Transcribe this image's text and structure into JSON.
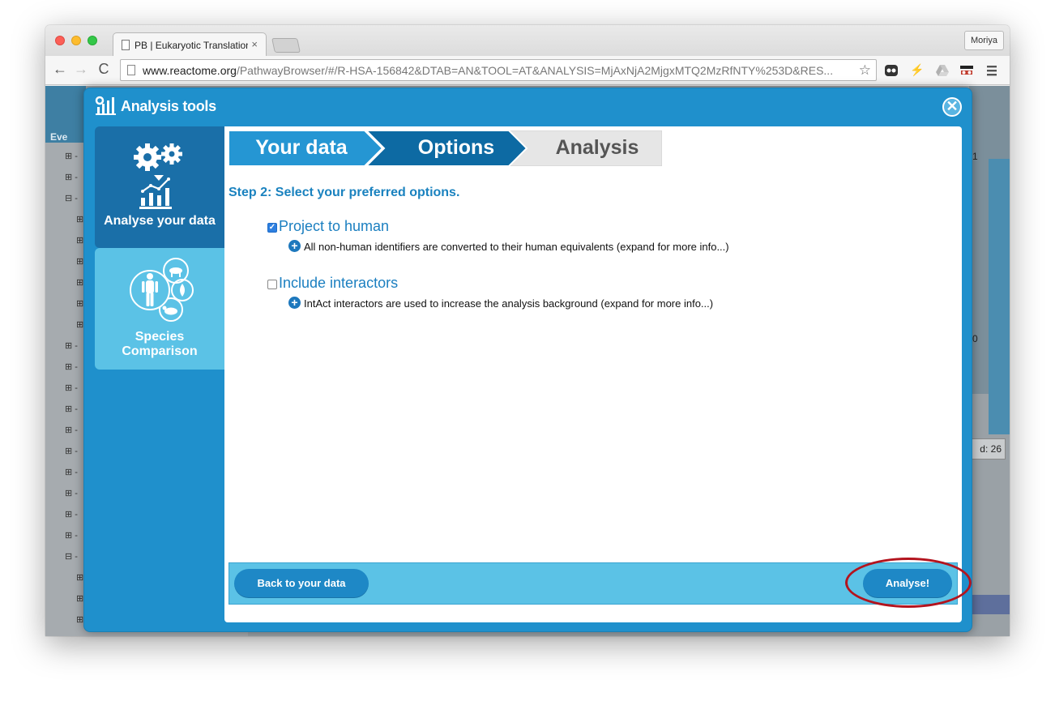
{
  "browser": {
    "tab_title": "PB | Eukaryotic Translation",
    "tab_close": "×",
    "profile_name": "Moriya",
    "url_domain": "www.reactome.org",
    "url_path": "/PathwayBrowser/#/R-HSA-156842&DTAB=AN&TOOL=AT&ANALYSIS=MjAxNjA2MjgxMTQ2MzRfNTY%253D&RES...",
    "back_icon": "←",
    "forward_icon": "→",
    "reload_icon": "C",
    "star_icon": "☆"
  },
  "background": {
    "side_label": "Eve",
    "right_value": "d: 26",
    "right_small_1": "1",
    "right_small_2": "0"
  },
  "dialog": {
    "title": "Analysis tools",
    "close_symbol": "✕",
    "nav": [
      {
        "label": "Analyse your data",
        "icon": "gears-chart-icon"
      },
      {
        "label": "Species Comparison",
        "icon": "species-icon"
      }
    ],
    "steps": [
      {
        "label": "Your data",
        "state": "done"
      },
      {
        "label": "Options",
        "state": "active"
      },
      {
        "label": "Analysis",
        "state": "pending"
      }
    ],
    "step_heading": "Step 2: Select your preferred options.",
    "options": [
      {
        "label": "Project to human",
        "checked": true,
        "description": "All non-human identifiers are converted to their human equivalents (expand for more info...)"
      },
      {
        "label": "Include interactors",
        "checked": false,
        "description": "IntAct interactors are used to increase the analysis background (expand for more info...)"
      }
    ],
    "back_button": "Back to your data",
    "analyse_button": "Analyse!"
  },
  "colors": {
    "dialog_blue": "#1f90cc",
    "step_active": "#0d6aa3",
    "step_done": "#2596d3",
    "footer": "#5bc2e6",
    "highlight_ring": "#b3141e"
  }
}
